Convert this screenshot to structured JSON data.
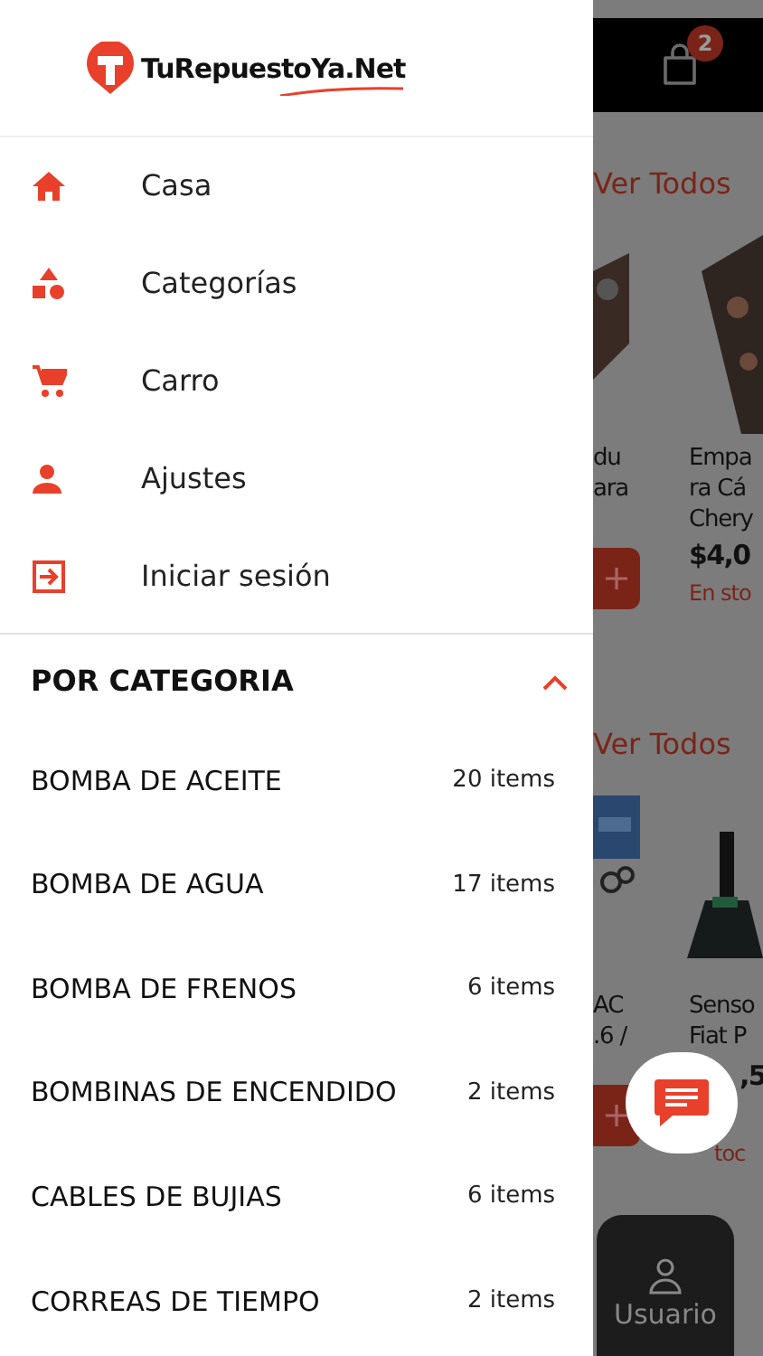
{
  "drawer": {
    "logo_text": "TuRepuestoYa.Net",
    "menu": [
      {
        "label": "Casa"
      },
      {
        "label": "Categorías"
      },
      {
        "label": "Carro"
      },
      {
        "label": "Ajustes"
      },
      {
        "label": "Iniciar sesión"
      }
    ],
    "categories": {
      "title": "POR CATEGORIA",
      "expanded": true,
      "items": [
        {
          "name": "BOMBA DE ACEITE",
          "count": "20 items"
        },
        {
          "name": "BOMBA DE AGUA",
          "count": "17 items"
        },
        {
          "name": "BOMBA DE FRENOS",
          "count": "6 items"
        },
        {
          "name": "BOMBINAS DE ENCENDIDO",
          "count": "2 items"
        },
        {
          "name": "CABLES DE BUJIAS",
          "count": "6 items"
        },
        {
          "name": "CORREAS DE TIEMPO",
          "count": "2 items"
        }
      ]
    }
  },
  "background": {
    "cart_badge": "2",
    "sections": [
      {
        "link": "Ver Todos",
        "products": [
          {
            "title_lines": [
              "du",
              "ara"
            ]
          },
          {
            "title_lines": [
              "Empa",
              "ra Cá",
              "Chery"
            ],
            "price": "$4,0",
            "stock": "En sto"
          }
        ]
      },
      {
        "link": "Ver Todos",
        "products": [
          {
            "title_lines": [
              "AC",
              ".6 /"
            ]
          },
          {
            "title_lines": [
              "Senso",
              "Fiat P"
            ],
            "price": ",5",
            "stock": "toc"
          }
        ]
      }
    ],
    "tab": "Usuario"
  }
}
